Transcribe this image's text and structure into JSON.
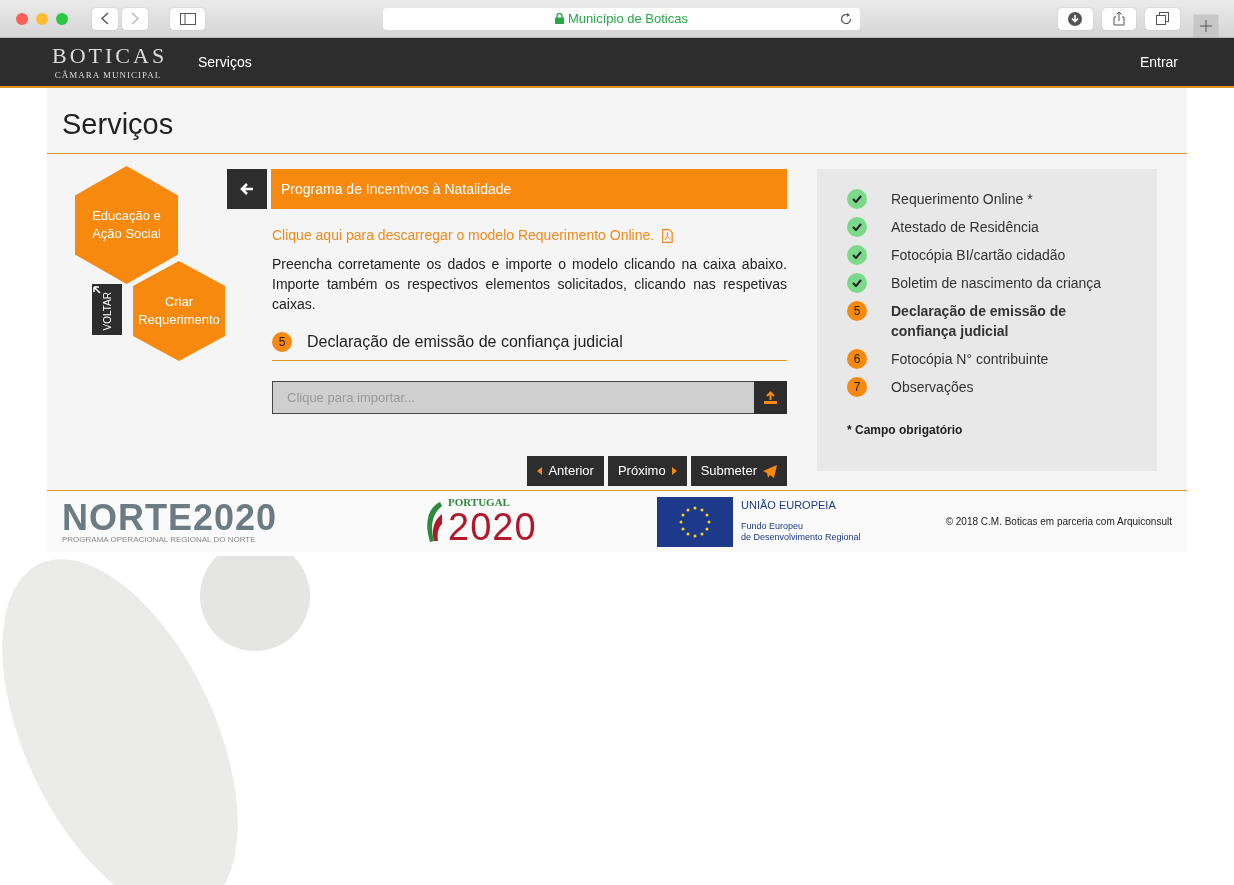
{
  "browser": {
    "address": "Município de Boticas"
  },
  "navbar": {
    "logo_title": "BOTICAS",
    "logo_subtitle": "CÂMARA MUNICIPAL",
    "links": [
      {
        "label": "Serviços"
      }
    ],
    "login": "Entrar"
  },
  "page_title": "Serviços",
  "side_menu": {
    "category": "Educação e Ação Social",
    "action": "Criar Requerimento",
    "back": "VOLTAR"
  },
  "form": {
    "title": "Programa de Incentivos à Natalidade",
    "download_link": "Clique aqui para descarregar o modelo Requerimento Online.",
    "instructions": "Preencha corretamente os dados e importe o modelo clicando na caixa abaixo. Importe também os respectivos elementos solicitados, clicando nas respetivas caixas.",
    "step_number": "5",
    "step_title": "Declaração de emissão de confiança judicial",
    "file_field": {
      "placeholder": "Clique para importar..."
    },
    "buttons": [
      {
        "kind": "prev",
        "label": "Anterior"
      },
      {
        "kind": "next",
        "label": "Próximo"
      },
      {
        "kind": "submit",
        "label": "Submeter"
      }
    ]
  },
  "steps": [
    {
      "kind": "done",
      "label": "Requerimento Online *"
    },
    {
      "kind": "done",
      "label": "Atestado de Residência"
    },
    {
      "kind": "done",
      "label": "Fotocópia BI/cartão cidadão"
    },
    {
      "kind": "done",
      "label": "Boletim de nascimento da criança"
    },
    {
      "kind": "current",
      "number": "5",
      "label": "Declaração de emissão de confiança judicial"
    },
    {
      "kind": "pending",
      "number": "6",
      "label": "Fotocópia N° contribuinte"
    },
    {
      "kind": "pending",
      "number": "7",
      "label": "Observações"
    }
  ],
  "required_note": "* Campo obrigatório",
  "footer": {
    "norte_logo": "NORTE2020",
    "norte_caption": "PROGRAMA OPERACIONAL REGIONAL DO NORTE",
    "portugal_label": "PORTUGAL",
    "portugal_year": "2020",
    "eu_title": "UNIÃO EUROPEIA",
    "eu_fund_line1": "Fundo Europeu",
    "eu_fund_line2": "de Desenvolvimento Regional",
    "copyright": "© 2018 C.M. Boticas em parceria com Arquiconsult"
  }
}
